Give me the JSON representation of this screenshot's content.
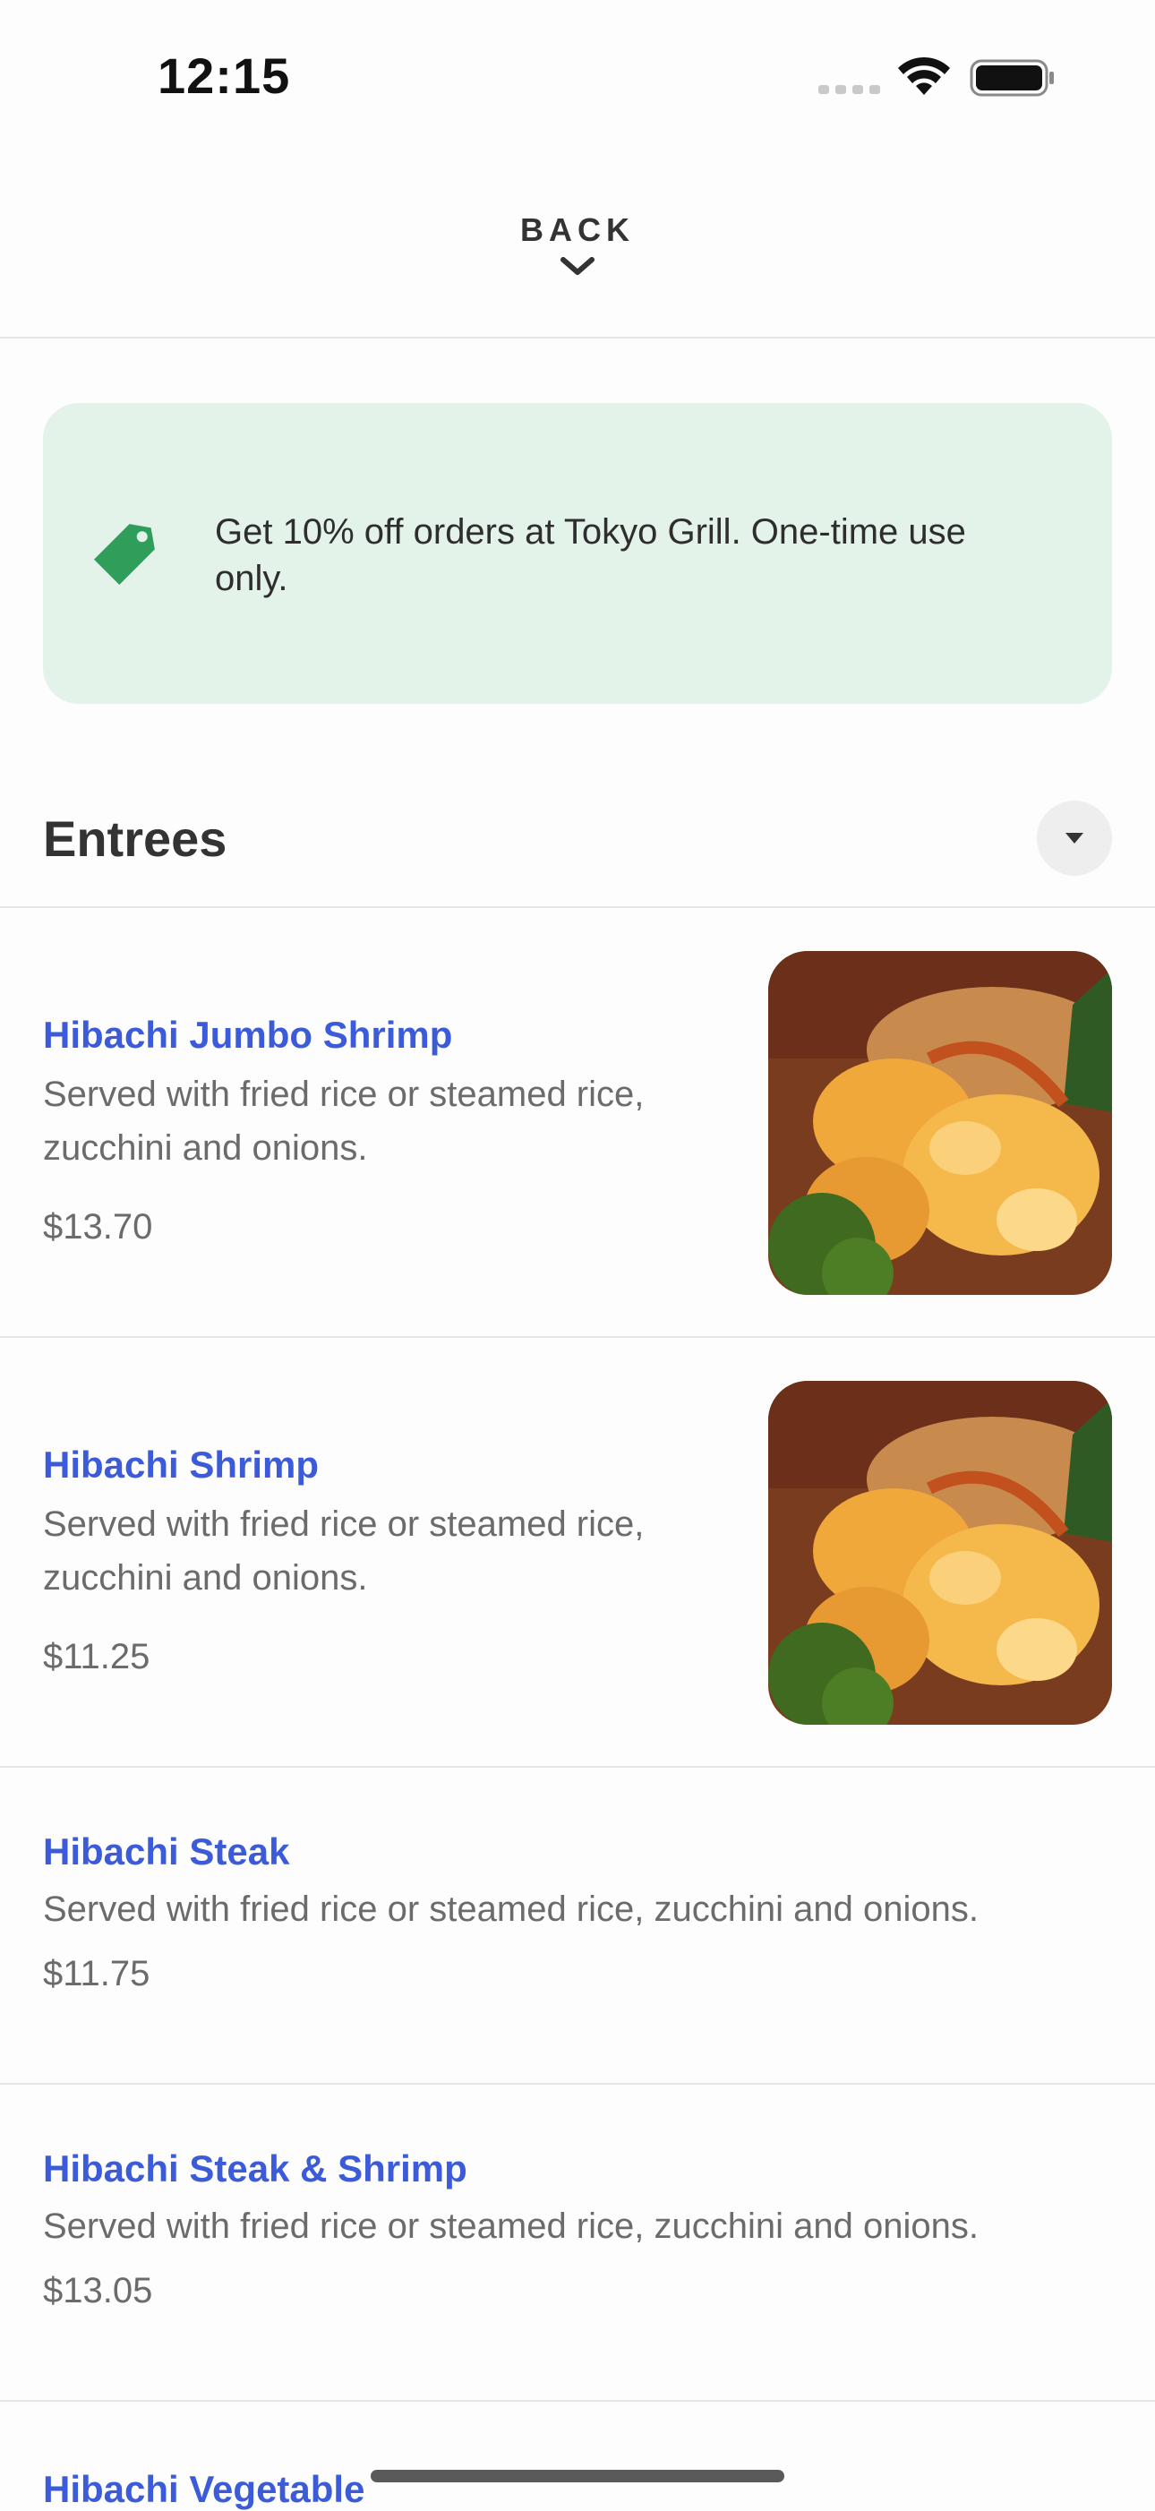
{
  "status_bar": {
    "time": "12:15"
  },
  "header": {
    "back_label": "BACK"
  },
  "promo": {
    "text": "Get 10% off orders at Tokyo Grill. One-time use only.",
    "accent_color": "#2f9e5a",
    "background_color": "#e4f3ea"
  },
  "section": {
    "title": "Entrees"
  },
  "items": [
    {
      "name": "Hibachi Jumbo Shrimp",
      "description": "Served with fried rice or steamed rice, zucchini and onions.",
      "price": "$13.70"
    },
    {
      "name": "Hibachi Shrimp",
      "description": "Served with fried rice or steamed rice, zucchini and onions.",
      "price": "$11.25"
    },
    {
      "name": "Hibachi Steak",
      "description": "Served with fried rice or steamed rice, zucchini and onions.",
      "price": "$11.75"
    },
    {
      "name": "Hibachi Steak & Shrimp",
      "description": "Served with fried rice or steamed rice, zucchini and onions.",
      "price": "$13.05"
    },
    {
      "name": "Hibachi Vegetable"
    }
  ],
  "colors": {
    "link": "#3c5bd8",
    "text_secondary": "#6b6b6b"
  }
}
